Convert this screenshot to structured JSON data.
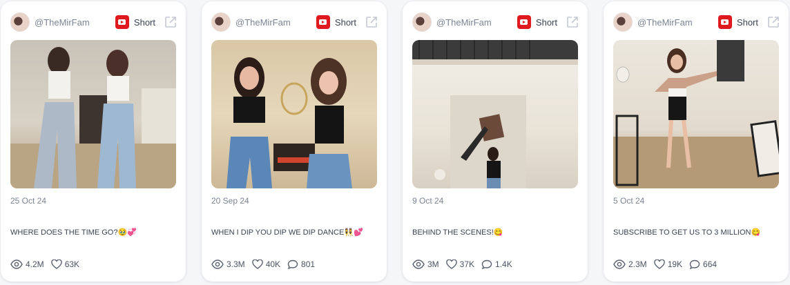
{
  "cards": [
    {
      "handle": "@TheMirFam",
      "badge": "Short",
      "date": "25 Oct 24",
      "caption": "WHERE DOES THE TIME GO?🥹💞",
      "views": "4.2M",
      "likes": "63K",
      "comments": ""
    },
    {
      "handle": "@TheMirFam",
      "badge": "Short",
      "date": "20 Sep 24",
      "caption": "WHEN I DIP YOU DIP WE DIP DANCE👯💕",
      "views": "3.3M",
      "likes": "40K",
      "comments": "801"
    },
    {
      "handle": "@TheMirFam",
      "badge": "Short",
      "date": "9 Oct 24",
      "caption": "BEHIND THE SCENES!😋",
      "views": "3M",
      "likes": "37K",
      "comments": "1.4K"
    },
    {
      "handle": "@TheMirFam",
      "badge": "Short",
      "date": "5 Oct 24",
      "caption": "SUBSCRIBE TO GET US TO 3 MILLION😋",
      "views": "2.3M",
      "likes": "19K",
      "comments": "664"
    }
  ],
  "colors": {
    "youtube_red": "#e0191e",
    "muted_text": "#7b8494",
    "card_bg": "#ffffff"
  },
  "icons": {
    "platform": "youtube-icon",
    "external": "external-link-icon",
    "views": "eye-icon",
    "likes": "heart-icon",
    "comments": "comment-icon"
  }
}
